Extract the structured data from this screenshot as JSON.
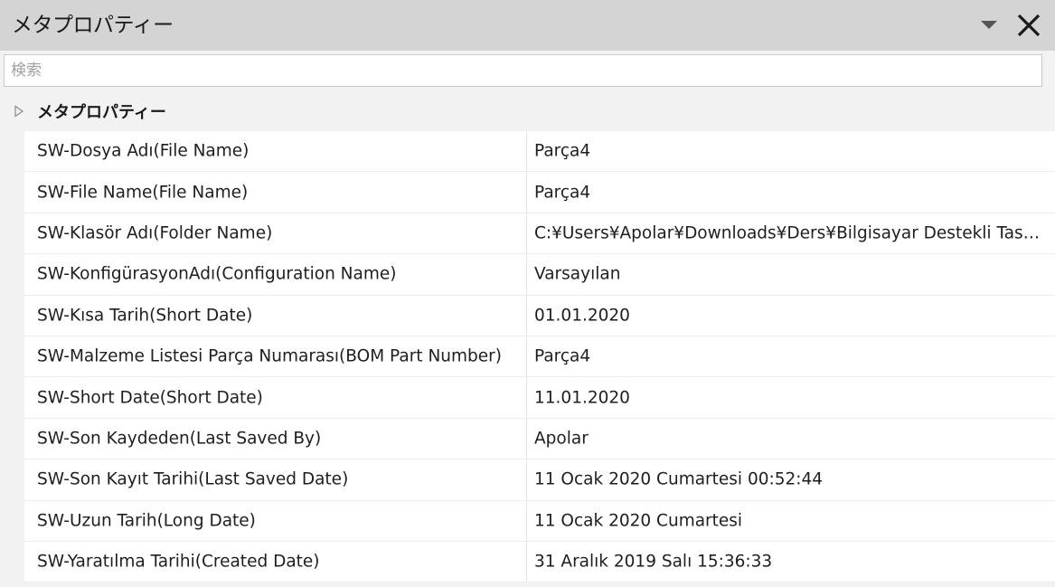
{
  "panel": {
    "title": "メタプロパティー",
    "search_placeholder": "検索",
    "group_label": "メタプロパティー",
    "icons": {
      "dropdown": "triangle-down-icon",
      "close": "close-icon",
      "expander": "triangle-right-icon"
    }
  },
  "properties": [
    {
      "name": "SW-Dosya Adı(File Name)",
      "value": "Parça4"
    },
    {
      "name": "SW-File Name(File Name)",
      "value": "Parça4"
    },
    {
      "name": "SW-Klasör Adı(Folder Name)",
      "value": "C:¥Users¥Apolar¥Downloads¥Ders¥Bilgisayar Destekli Tasarım¥"
    },
    {
      "name": "SW-KonfigürasyonAdı(Configuration Name)",
      "value": "Varsayılan"
    },
    {
      "name": "SW-Kısa Tarih(Short Date)",
      "value": "01.01.2020"
    },
    {
      "name": "SW-Malzeme Listesi Parça Numarası(BOM Part Number)",
      "value": "Parça4"
    },
    {
      "name": "SW-Short Date(Short Date)",
      "value": "11.01.2020"
    },
    {
      "name": "SW-Son Kaydeden(Last Saved By)",
      "value": "Apolar"
    },
    {
      "name": "SW-Son Kayıt Tarihi(Last Saved Date)",
      "value": "11 Ocak 2020 Cumartesi 00:52:44"
    },
    {
      "name": "SW-Uzun Tarih(Long Date)",
      "value": "11 Ocak 2020 Cumartesi"
    },
    {
      "name": "SW-Yaratılma Tarihi(Created Date)",
      "value": "31 Aralık 2019 Salı 15:36:33"
    }
  ]
}
